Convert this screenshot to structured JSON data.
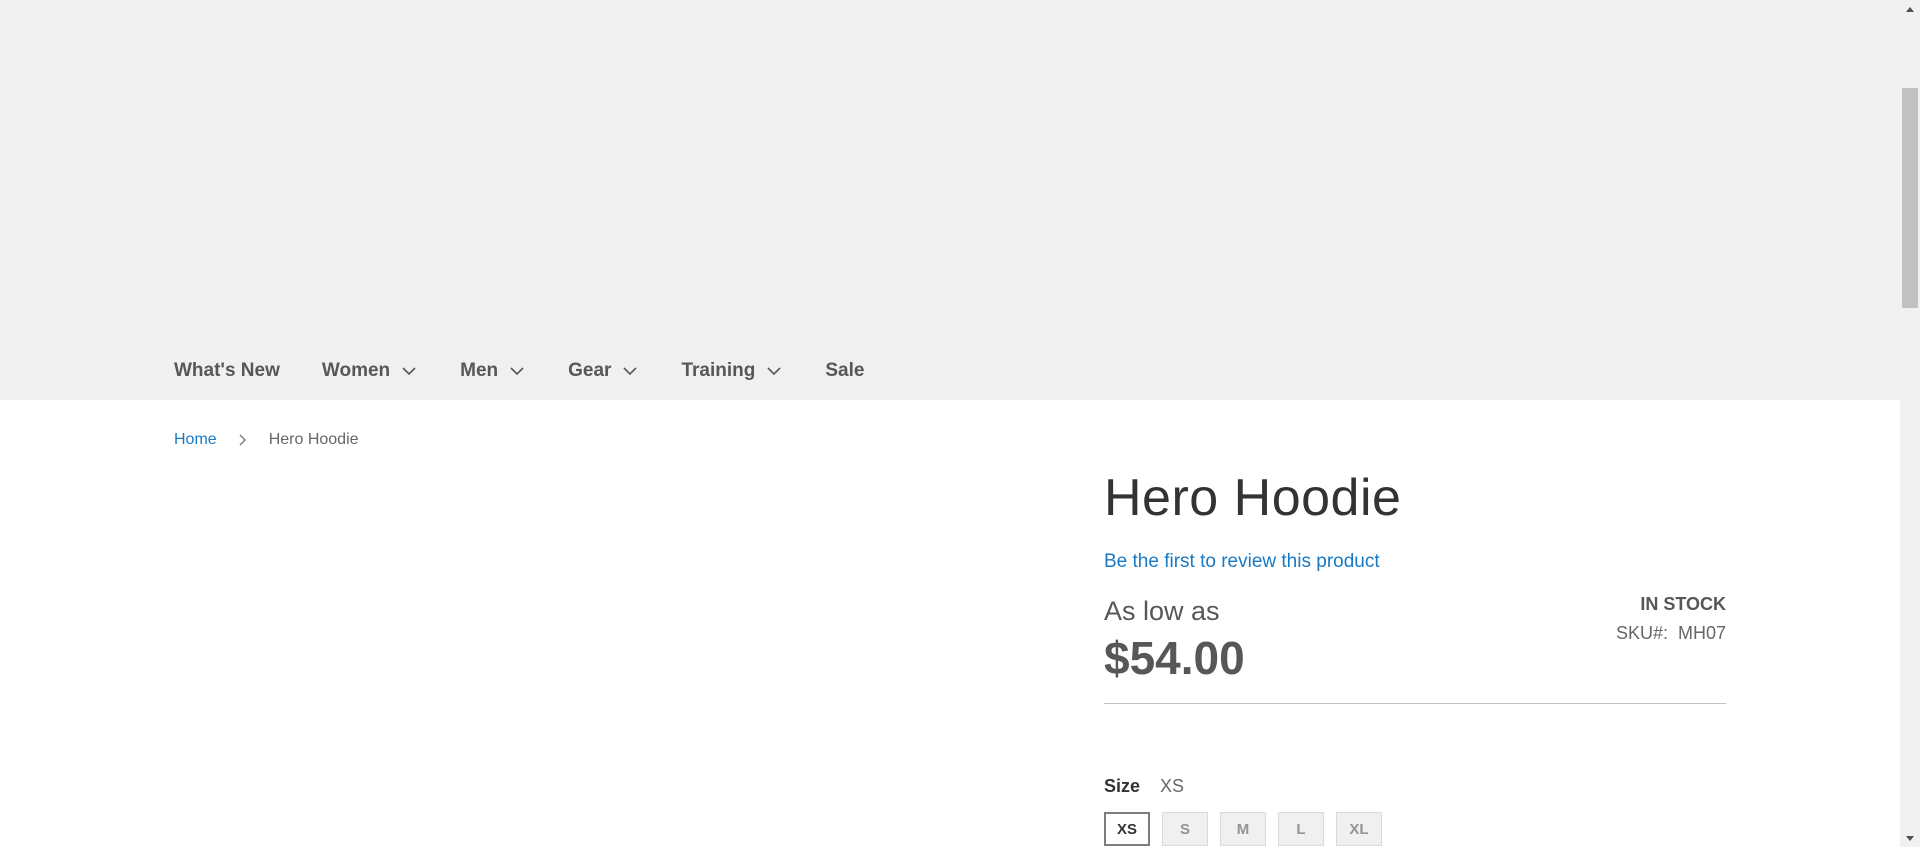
{
  "nav": {
    "items": [
      {
        "label": "What's New",
        "has_dropdown": false
      },
      {
        "label": "Women",
        "has_dropdown": true
      },
      {
        "label": "Men",
        "has_dropdown": true
      },
      {
        "label": "Gear",
        "has_dropdown": true
      },
      {
        "label": "Training",
        "has_dropdown": true
      },
      {
        "label": "Sale",
        "has_dropdown": false
      }
    ]
  },
  "breadcrumb": {
    "home": "Home",
    "current": "Hero Hoodie"
  },
  "product": {
    "title": "Hero Hoodie",
    "review_link": "Be the first to review this product",
    "price_label": "As low as",
    "price": "$54.00",
    "stock": "IN STOCK",
    "sku_label": "SKU#:",
    "sku_value": "MH07"
  },
  "size": {
    "label": "Size",
    "selected": "XS",
    "options": [
      "XS",
      "S",
      "M",
      "L",
      "XL"
    ]
  },
  "colors": {
    "link": "#1979c3",
    "header_bg": "#f0f0f0",
    "text_dark": "#575757"
  }
}
